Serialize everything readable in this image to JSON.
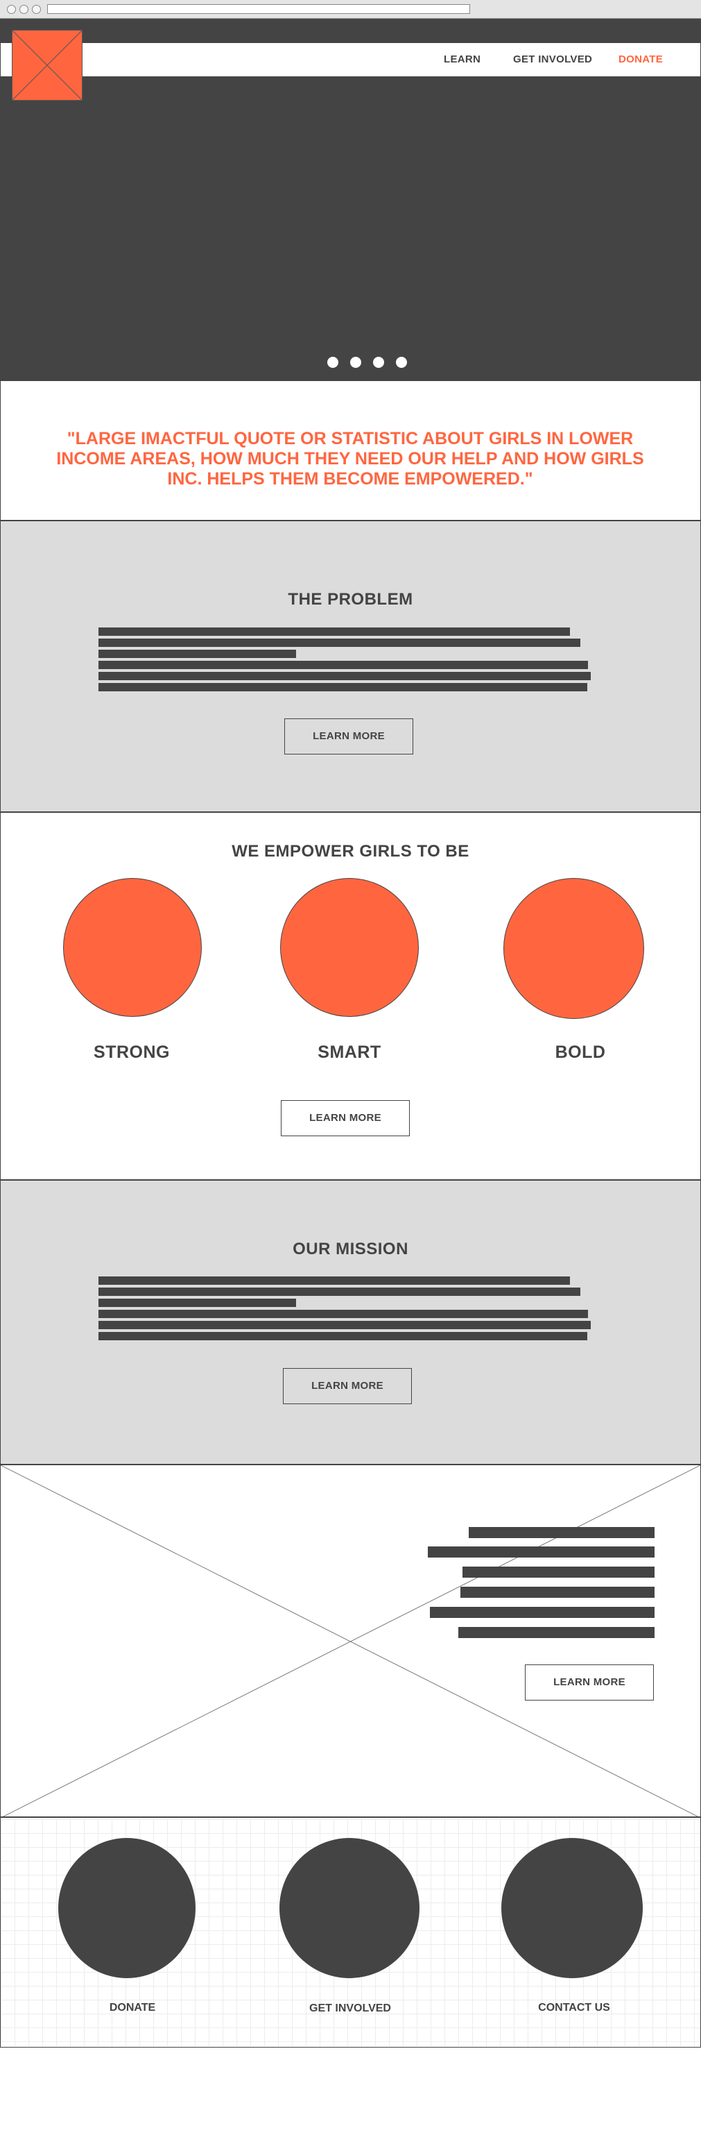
{
  "nav": {
    "learn": "LEARN",
    "get_involved": "GET INVOLVED",
    "donate": "DONATE"
  },
  "quote": {
    "text": "\"LARGE IMACTFUL QUOTE OR STATISTIC ABOUT GIRLS IN LOWER INCOME AREAS, HOW MUCH THEY NEED OUR HELP AND HOW GIRLS INC. HELPS THEM BECOME EMPOWERED.\""
  },
  "problem": {
    "title": "THE PROBLEM",
    "button": "LEARN MORE"
  },
  "empower": {
    "title": "WE EMPOWER GIRLS TO BE",
    "qualities": [
      "STRONG",
      "SMART",
      "BOLD"
    ],
    "button": "LEARN MORE"
  },
  "mission": {
    "title": "OUR MISSION",
    "button": "LEARN MORE"
  },
  "feature": {
    "button": "LEARN MORE"
  },
  "footer": {
    "items": [
      "DONATE",
      "GET INVOLVED",
      "CONTACT US"
    ]
  },
  "colors": {
    "accent": "#ff6640",
    "dark": "#444444",
    "panel": "#dcdcdc"
  }
}
